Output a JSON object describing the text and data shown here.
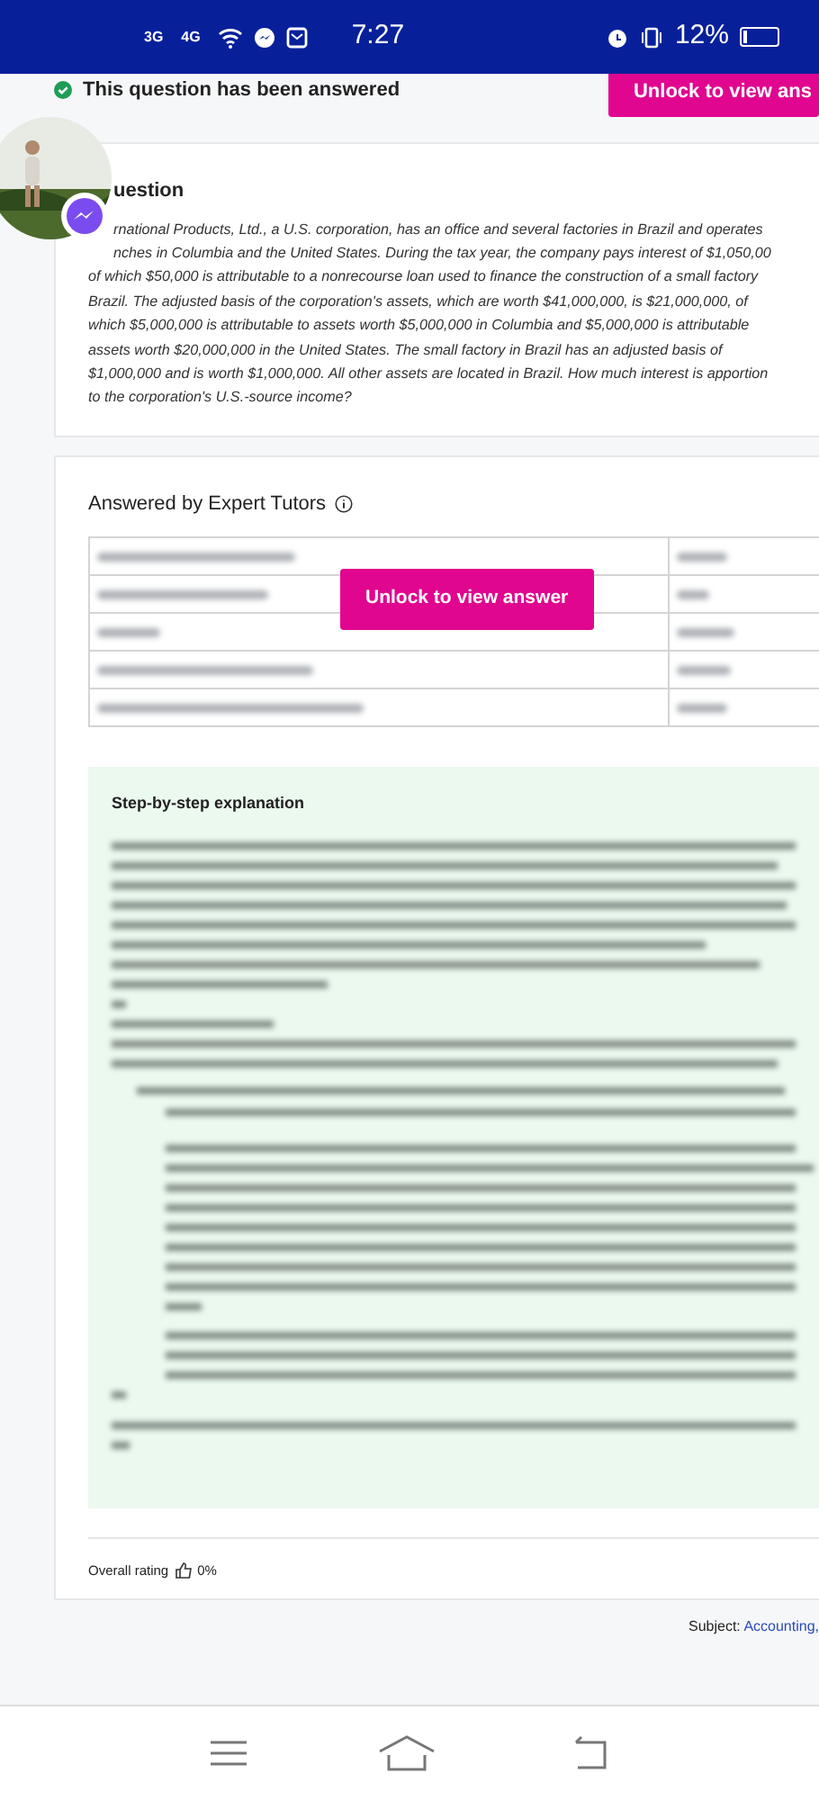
{
  "status_bar": {
    "network_1": "3G",
    "network_2": "4G",
    "time": "7:27",
    "battery": "12%"
  },
  "header": {
    "answered_label": "This question has been answered",
    "unlock_button": "Unlock to view ans"
  },
  "question": {
    "title": "uestion",
    "lines": [
      "rnational Products, Ltd., a U.S. corporation, has an office and several factories in Brazil and operates",
      "nches in Columbia and the United States. During the tax year, the company pays interest of $1,050,00",
      "of which $50,000 is attributable to a nonrecourse loan used to finance the construction of a small factory",
      "Brazil. The adjusted basis of the corporation's assets, which are worth $41,000,000, is $21,000,000, of",
      "which $5,000,000 is attributable to assets worth $5,000,000 in Columbia and $5,000,000 is attributable",
      "assets worth $20,000,000 in the United States. The small factory in Brazil has an adjusted basis of",
      "$1,000,000 and is worth $1,000,000. All other assets are located in Brazil. How much interest is apportion",
      "to the corporation's U.S.-source income?"
    ]
  },
  "answer": {
    "title": "Answered by Expert Tutors",
    "unlock_button": "Unlock to view answer",
    "explanation_title": "Step-by-step explanation",
    "rating_label": "Overall rating",
    "rating_value": "0%"
  },
  "subject": {
    "label": "Subject:",
    "link": "Accounting,"
  }
}
